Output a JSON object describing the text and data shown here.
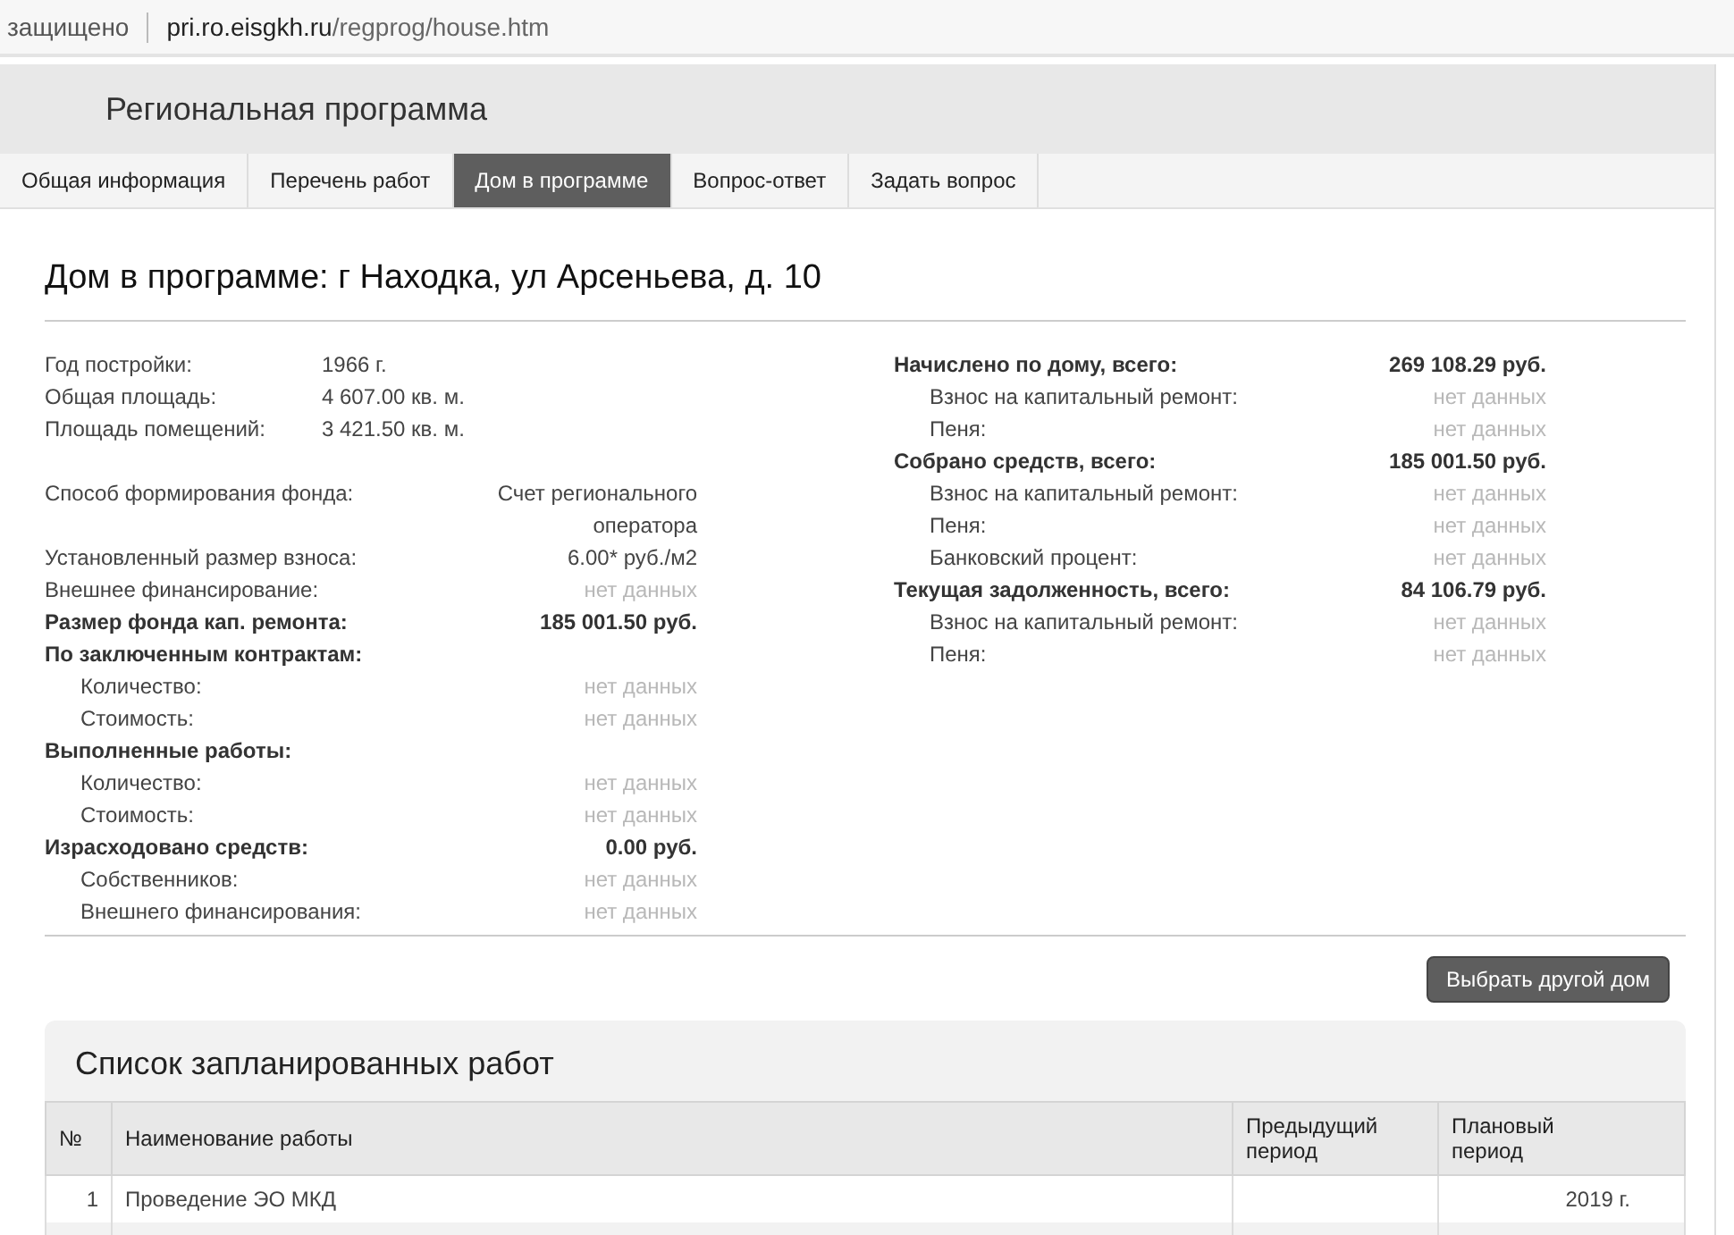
{
  "address_bar": {
    "security": "защищено",
    "host": "pri.ro.eisgkh.ru",
    "path": "/regprog/house.htm"
  },
  "header": {
    "title": "Региональная программа"
  },
  "tabs": [
    {
      "label": "Общая информация",
      "selected": false
    },
    {
      "label": "Перечень работ",
      "selected": false
    },
    {
      "label": "Дом в программе",
      "selected": true
    },
    {
      "label": "Вопрос-ответ",
      "selected": false
    },
    {
      "label": "Задать вопрос",
      "selected": false
    }
  ],
  "page_title": "Дом в программе: г Находка, ул Арсеньева, д. 10",
  "left_sections": [
    {
      "kind": "inline",
      "rows": [
        {
          "kind": "plain",
          "label": "Год постройки:",
          "value": "1966 г.",
          "empty": false
        },
        {
          "kind": "plain",
          "label": "Общая площадь:",
          "value": "4 607.00 кв. м.",
          "empty": false
        },
        {
          "kind": "plain",
          "label": "Площадь помещений:",
          "value": "3 421.50 кв. м.",
          "empty": false
        }
      ]
    },
    {
      "kind": "right",
      "rows": [
        {
          "kind": "plain",
          "label": "Способ формирования фонда:",
          "value": "Счет регионального оператора",
          "empty": false
        },
        {
          "kind": "plain",
          "label": "Установленный размер взноса:",
          "value": "6.00* руб./м2",
          "empty": false
        },
        {
          "kind": "plain",
          "label": "Внешнее финансирование:",
          "value": "нет данных",
          "empty": true
        },
        {
          "kind": "total",
          "label": "Размер фонда кап. ремонта:",
          "value": "185 001.50 руб.",
          "empty": false
        },
        {
          "kind": "total",
          "label": "По заключенным контрактам:"
        },
        {
          "kind": "sub",
          "label": "Количество:",
          "value": "нет данных",
          "empty": true
        },
        {
          "kind": "sub",
          "label": "Стоимость:",
          "value": "нет данных",
          "empty": true
        },
        {
          "kind": "total",
          "label": "Выполненные работы:"
        },
        {
          "kind": "sub",
          "label": "Количество:",
          "value": "нет данных",
          "empty": true
        },
        {
          "kind": "sub",
          "label": "Стоимость:",
          "value": "нет данных",
          "empty": true
        },
        {
          "kind": "total",
          "label": "Израсходовано средств:",
          "value": "0.00 руб.",
          "empty": false
        },
        {
          "kind": "sub",
          "label": "Собственников:",
          "value": "нет данных",
          "empty": true
        },
        {
          "kind": "sub",
          "label": "Внешнего финансирования:",
          "value": "нет данных",
          "empty": true
        }
      ]
    }
  ],
  "right_rows": [
    {
      "kind": "total",
      "label": "Начислено по дому, всего:",
      "value": "269 108.29 руб.",
      "empty": false
    },
    {
      "kind": "sub",
      "label": "Взнос на капитальный ремонт:",
      "value": "нет данных",
      "empty": true
    },
    {
      "kind": "sub",
      "label": "Пеня:",
      "value": "нет данных",
      "empty": true
    },
    {
      "kind": "total",
      "label": "Собрано средств, всего:",
      "value": "185 001.50 руб.",
      "empty": false
    },
    {
      "kind": "sub",
      "label": "Взнос на капитальный ремонт:",
      "value": "нет данных",
      "empty": true
    },
    {
      "kind": "sub",
      "label": "Пеня:",
      "value": "нет данных",
      "empty": true
    },
    {
      "kind": "sub",
      "label": "Банковский процент:",
      "value": "нет данных",
      "empty": true
    },
    {
      "kind": "total",
      "label": "Текущая задолженность, всего:",
      "value": "84 106.79 руб.",
      "empty": false
    },
    {
      "kind": "sub",
      "label": "Взнос на капитальный ремонт:",
      "value": "нет данных",
      "empty": true
    },
    {
      "kind": "sub",
      "label": "Пеня:",
      "value": "нет данных",
      "empty": true
    }
  ],
  "choose_button": "Выбрать другой дом",
  "works": {
    "title": "Список запланированных работ",
    "columns": [
      "№",
      "Наименование работы",
      "Предыдущий период",
      "Плановый период"
    ],
    "rows": [
      [
        "1",
        "Проведение ЭО МКД",
        "",
        "2019 г."
      ]
    ]
  }
}
